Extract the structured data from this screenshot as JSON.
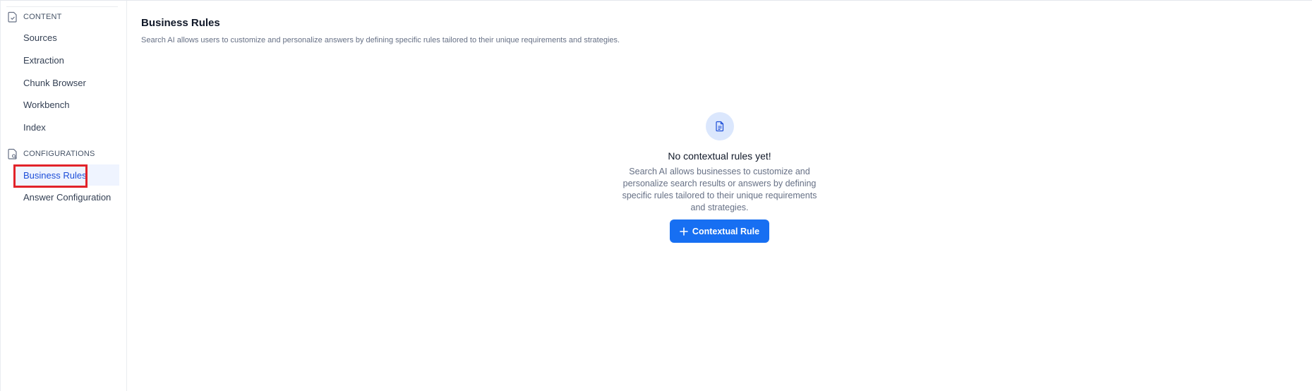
{
  "sidebar": {
    "sections": [
      {
        "title": "CONTENT",
        "icon": "document-check-icon",
        "items": [
          {
            "label": "Sources"
          },
          {
            "label": "Extraction"
          },
          {
            "label": "Chunk Browser"
          },
          {
            "label": "Workbench"
          },
          {
            "label": "Index"
          }
        ]
      },
      {
        "title": "CONFIGURATIONS",
        "icon": "document-search-icon",
        "items": [
          {
            "label": "Business Rules",
            "active": true
          },
          {
            "label": "Answer Configuration"
          }
        ]
      }
    ]
  },
  "main": {
    "title": "Business Rules",
    "subtitle": "Search AI allows users to customize and personalize answers by defining specific rules tailored to their unique requirements and strategies.",
    "empty_state": {
      "icon": "document-icon",
      "title": "No contextual rules yet!",
      "description": "Search AI allows businesses to customize and personalize search results or answers by defining specific rules tailored to their unique requirements and strategies.",
      "button_label": "Contextual Rule",
      "button_icon": "plus-icon"
    }
  },
  "colors": {
    "accent": "#176ff2",
    "active_bg": "#eff4ff",
    "active_text": "#1d4ed8",
    "highlight": "#e2232a"
  }
}
